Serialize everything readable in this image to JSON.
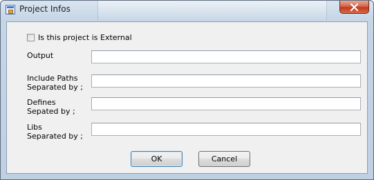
{
  "window": {
    "title": "Project Infos"
  },
  "form": {
    "external_checkbox": {
      "label": "Is this project is External",
      "checked": false
    },
    "fields": [
      {
        "label": "Output",
        "value": ""
      },
      {
        "label": "Include Paths\nSeparated by ;",
        "value": ""
      },
      {
        "label": "Defines\nSepated by ;",
        "value": ""
      },
      {
        "label": "Libs\nSeparated by ;",
        "value": ""
      }
    ]
  },
  "buttons": {
    "ok": "OK",
    "cancel": "Cancel"
  },
  "icons": {
    "app": "project-window-icon",
    "close": "close-icon"
  },
  "colors": {
    "close_button": "#c0391b",
    "frame": "#bfd0e2",
    "client": "#f0f0f0"
  }
}
